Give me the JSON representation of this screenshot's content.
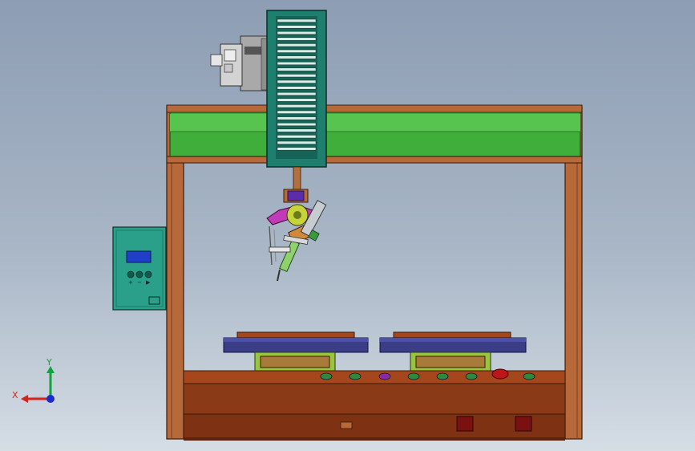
{
  "scene": {
    "colors": {
      "background_top": "#8d9db3",
      "background_bottom": "#d5dde5",
      "frame_wood": "#b8693a",
      "frame_wood_dark": "#7a3f1e",
      "beam_green": "#3fae3a",
      "beam_green_light": "#6fd26a",
      "carriage_teal": "#1f7f6f",
      "base_brown": "#8a3a17",
      "tray_navy": "#3b3d86",
      "control_box": "#2aa08a",
      "display_blue": "#1f3fc8",
      "motor_grey": "#b9b9b9",
      "button_red": "#c0141b"
    },
    "control_panel": {
      "button_labels": [
        "+",
        "−",
        "▶"
      ]
    },
    "axis_triad": {
      "x_label": "X",
      "y_label": "Y",
      "x_color": "#d0241c",
      "y_color": "#12a33a",
      "z_color": "#1c2bd0"
    }
  }
}
